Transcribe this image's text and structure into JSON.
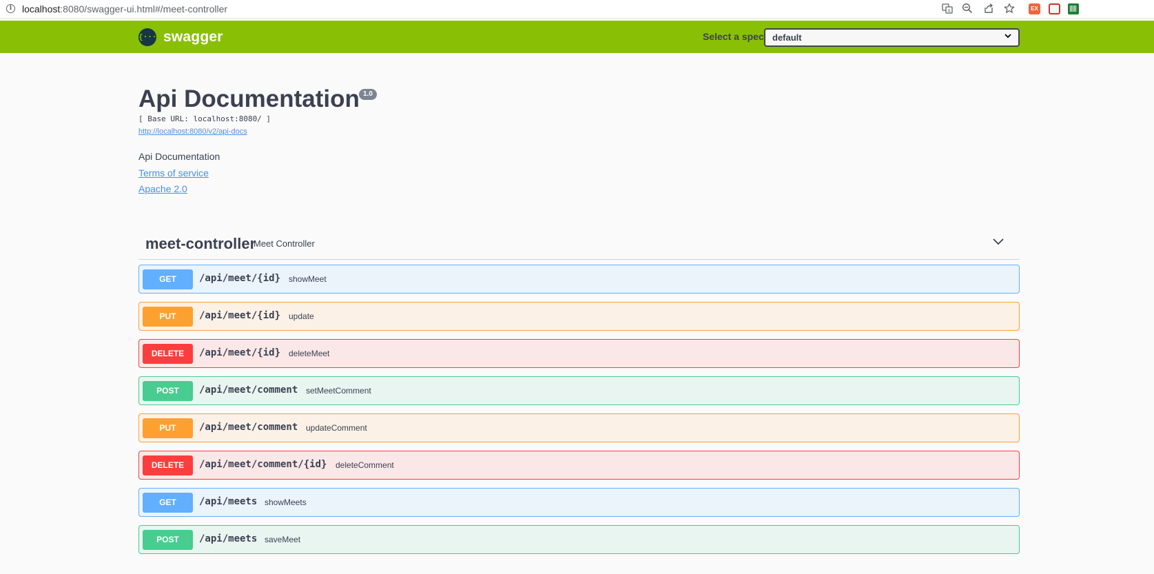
{
  "browser": {
    "url_host": "localhost",
    "url_rest": ":8080/swagger-ui.html#/meet-controller"
  },
  "topbar": {
    "logo_text": "swagger",
    "logo_glyph": "{···}",
    "spec_label": "Select a spec",
    "spec_value": "default"
  },
  "info": {
    "title": "Api Documentation",
    "version": "1.0",
    "base_url": "[ Base URL: localhost:8080/ ]",
    "docs_link": "http://localhost:8080/v2/api-docs",
    "description": "Api Documentation",
    "terms": "Terms of service",
    "license": "Apache 2.0"
  },
  "tag": {
    "name": "meet-controller",
    "description": "Meet Controller"
  },
  "operations": [
    {
      "method": "GET",
      "path": "/api/meet/{id}",
      "summary": "showMeet"
    },
    {
      "method": "PUT",
      "path": "/api/meet/{id}",
      "summary": "update"
    },
    {
      "method": "DELETE",
      "path": "/api/meet/{id}",
      "summary": "deleteMeet"
    },
    {
      "method": "POST",
      "path": "/api/meet/comment",
      "summary": "setMeetComment"
    },
    {
      "method": "PUT",
      "path": "/api/meet/comment",
      "summary": "updateComment"
    },
    {
      "method": "DELETE",
      "path": "/api/meet/comment/{id}",
      "summary": "deleteComment"
    },
    {
      "method": "GET",
      "path": "/api/meets",
      "summary": "showMeets"
    },
    {
      "method": "POST",
      "path": "/api/meets",
      "summary": "saveMeet"
    }
  ],
  "colors": {
    "topbar": "#89bf04",
    "get": "#61affe",
    "put": "#fca130",
    "delete": "#f93e3e",
    "post": "#49cc90"
  },
  "icons": {
    "info": "info-icon",
    "translate": "translate-icon",
    "zoom": "zoom-out-icon",
    "share": "share-icon",
    "bookmark": "star-icon"
  }
}
